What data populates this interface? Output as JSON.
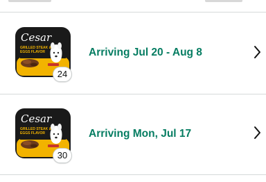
{
  "colors": {
    "status_green": "#067d62",
    "divider": "#d5d9d9",
    "tray_yellow": "#f2b300",
    "tray_dark": "#1a1a1a"
  },
  "orders": [
    {
      "status": "Arriving Jul 20 - Aug 8",
      "quantity": "24",
      "product_image": {
        "brand": "Cesar",
        "flavor_line1": "GRILLED STEAK &",
        "flavor_line2": "EGGS FLAVOR"
      },
      "chevron_icon": "chevron-right-icon"
    },
    {
      "status": "Arriving Mon, Jul 17",
      "quantity": "30",
      "product_image": {
        "brand": "Cesar",
        "flavor_line1": "GRILLED STEAK &",
        "flavor_line2": "EGGS FLAVOR"
      },
      "chevron_icon": "chevron-right-icon"
    }
  ]
}
